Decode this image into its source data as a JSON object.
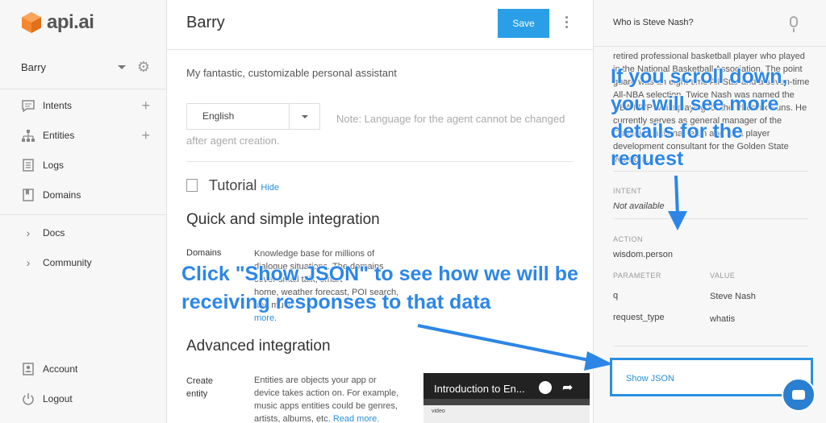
{
  "brand": {
    "logo_text": "api.ai",
    "accent_color": "#f7872e"
  },
  "sidebar": {
    "agent_name": "Barry",
    "items": [
      {
        "label": "Intents",
        "icon": "chat-icon",
        "has_plus": true
      },
      {
        "label": "Entities",
        "icon": "hierarchy-icon",
        "has_plus": true
      },
      {
        "label": "Logs",
        "icon": "list-icon",
        "has_plus": false
      },
      {
        "label": "Domains",
        "icon": "book-icon",
        "has_plus": false
      }
    ],
    "docs": [
      {
        "label": "Docs"
      },
      {
        "label": "Community"
      }
    ],
    "bottom": [
      {
        "label": "Account",
        "icon": "account-icon"
      },
      {
        "label": "Logout",
        "icon": "power-icon"
      }
    ]
  },
  "header": {
    "title": "Barry",
    "save_label": "Save"
  },
  "main": {
    "description": "My fantastic, customizable personal assistant",
    "language_value": "English",
    "language_note": "Note: Language for the agent cannot be changed after agent creation.",
    "tutorial_title": "Tutorial",
    "hide_label": "Hide",
    "quick_heading": "Quick and simple integration",
    "domains_label": "Domains",
    "domains_text_1": "Knowledge base for millions of",
    "domains_text_2": "dialogue situations. The domains",
    "domains_text_3": "cover small talk, smart",
    "domains_text_4": "home, weather forecast, POI search,",
    "domains_text_5": "and much",
    "domains_more": "more.",
    "advanced_heading": "Advanced integration",
    "create_entity_label_1": "Create",
    "create_entity_label_2": "entity",
    "entity_text": "Entities are objects your app or device takes action on. For example, music apps entities could be genres, artists, albums, etc.",
    "read_more": "Read more.",
    "video_title": "Introduction to En...",
    "video_small": "video"
  },
  "right_panel": {
    "query": "Who is Steve Nash?",
    "answer": "retired professional basketball player who played in the National Basketball Association. The point guard was an eight-time All-Star and a seven-time All-NBA selection. Twice Nash was named the NBA MVP while playing for the Phoenix Suns. He currently serves as general manager of the Canadian national team and as a player development consultant for the Golden State Warriors.",
    "intent_label": "INTENT",
    "intent_value": "Not available",
    "action_label": "ACTION",
    "action_value": "wisdom.person",
    "parameter_header": "PARAMETER",
    "value_header": "VALUE",
    "params": [
      {
        "name": "q",
        "value": "Steve Nash"
      },
      {
        "name": "request_type",
        "value": "whatis"
      }
    ],
    "show_json_label": "Show JSON"
  },
  "annotations": {
    "scroll_note": "If you scroll down, you will see more details for the request",
    "json_note": "Click \"Show JSON\" to see how we will be receiving responses to that data"
  }
}
